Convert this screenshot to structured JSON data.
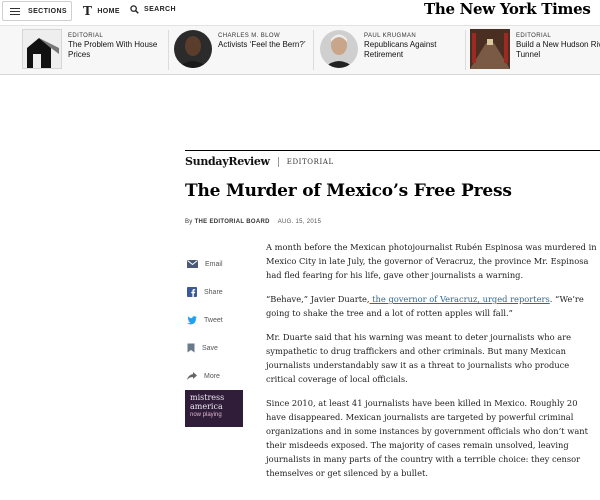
{
  "topbar": {
    "sections_label": "SECTIONS",
    "home_label": "HOME",
    "home_icon": "T",
    "search_label": "SEARCH",
    "masthead": "The New York Times"
  },
  "promos": [
    {
      "kicker": "EDITORIAL",
      "headline": "The Problem With House Prices",
      "image": "house-thumbnail"
    },
    {
      "kicker": "CHARLES M. BLOW",
      "headline": "Activists ‘Feel the Bern?’",
      "image": "author-photo"
    },
    {
      "kicker": "PAUL KRUGMAN",
      "headline": "Republicans Against Retirement",
      "image": "author-photo"
    },
    {
      "kicker": "EDITORIAL",
      "headline": "Build a New Hudson River Tunnel",
      "image": "tunnel-thumbnail"
    }
  ],
  "article": {
    "section": "SundayReview",
    "section_tag": "EDITORIAL",
    "headline": "The Murder of Mexico’s Free Press",
    "byline_prefix": "By",
    "byline_author": "THE EDITORIAL BOARD",
    "date": "AUG. 15, 2015",
    "p1": "A month before the Mexican photojournalist Rubén Espinosa was murdered in Mexico City in late July, the governor of Veracruz, the province Mr. Espinosa had fled fearing for his life, gave other journalists a warning.",
    "p2_before": "“Behave,” Javier Duarte,",
    "p2_link": " the governor of Veracruz, urged reporters",
    "p2_after": ". “We’re going to shake the tree and a lot of rotten apples will fall.”",
    "p3": "Mr. Duarte said that his warning was meant to deter journalists who are sympathetic to drug traffickers and other criminals. But many Mexican journalists understandably saw it as a threat to journalists who produce critical coverage of local officials.",
    "p4": "Since 2010, at least 41 journalists have been killed in Mexico. Roughly 20 have disappeared. Mexican journalists are targeted by powerful criminal organizations and in some instances by government officials who don’t want their misdeeds exposed. The majority of cases remain unsolved, leaving journalists in many parts of the country with a terrible choice: they censor themselves or get silenced by a bullet."
  },
  "share": {
    "email": "Email",
    "share": "Share",
    "tweet": "Tweet",
    "save": "Save",
    "more": "More"
  },
  "ad": {
    "line1": "mistress",
    "line2": "america",
    "line3": "now playing"
  },
  "colors": {
    "link": "#326891",
    "facebook": "#3b5998",
    "twitter": "#1da1f2",
    "ad_bg": "#2f1d3a"
  }
}
